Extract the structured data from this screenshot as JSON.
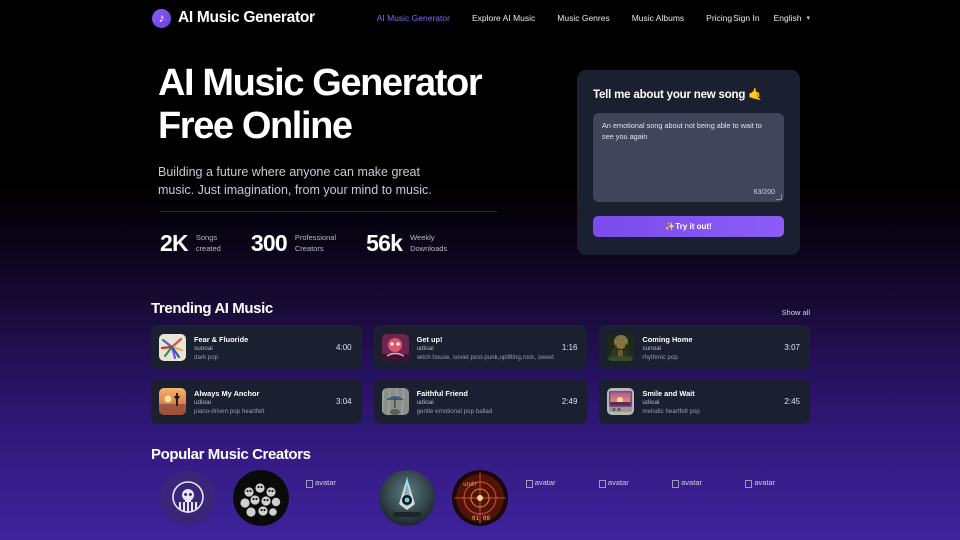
{
  "header": {
    "brand": "AI Music Generator",
    "logo_icon": "music-note-icon",
    "nav": [
      {
        "label": "AI Music Generator",
        "active": true
      },
      {
        "label": "Explore AI Music",
        "active": false
      },
      {
        "label": "Music Genres",
        "active": false
      },
      {
        "label": "Music Albums",
        "active": false
      },
      {
        "label": "Pricing",
        "active": false
      }
    ],
    "sign_in": "Sign In",
    "language": "English",
    "chevron_icon": "chevron-down-icon"
  },
  "hero": {
    "title_line1": "AI Music Generator",
    "title_line2": "Free Online",
    "subtitle": "Building a future where anyone can make great music. Just imagination, from your mind to music.",
    "stats": [
      {
        "number": "2K",
        "label_line1": "Songs",
        "label_line2": "created"
      },
      {
        "number": "300",
        "label_line1": "Professional",
        "label_line2": "Creators"
      },
      {
        "number": "56k",
        "label_line1": "Weekly",
        "label_line2": "Downloads"
      }
    ]
  },
  "prompt_card": {
    "title": "Tell me about your new song 🤙",
    "textarea_value": "An emotional song about not being able to wait to see you again",
    "textarea_placeholder": "Tell me about your new song",
    "counter": "63/200",
    "cta_label": "✨Try it out!",
    "accent_color": "#8b5cf6",
    "card_bg": "#1b2030"
  },
  "trending": {
    "title": "Trending AI Music",
    "show_all": "Show all",
    "tracks": [
      {
        "title": "Fear & Fluoride",
        "artist": "sunoai",
        "genre": "dark pop",
        "duration": "4:00"
      },
      {
        "title": "Get up!",
        "artist": "udioai",
        "genre": "witch house, soviet post-punk,uplifting,rock, sweet",
        "duration": "1:16"
      },
      {
        "title": "Coming Home",
        "artist": "sunoai",
        "genre": "rhythmic pop",
        "duration": "3:07"
      },
      {
        "title": "Always My Anchor",
        "artist": "udioai",
        "genre": "piano-driven pop heartfelt",
        "duration": "3:04"
      },
      {
        "title": "Faithful Friend",
        "artist": "udioai",
        "genre": "gentle emotional pop ballad",
        "duration": "2:49"
      },
      {
        "title": "Smile and Wait",
        "artist": "udioai",
        "genre": "melodic heartfelt pop",
        "duration": "2:45"
      }
    ]
  },
  "creators": {
    "title": "Popular Music Creators",
    "items": [
      {
        "alt": "avatar",
        "broken": false
      },
      {
        "alt": "avatar",
        "broken": false
      },
      {
        "alt": "avatar",
        "broken": true
      },
      {
        "alt": "avatar",
        "broken": false
      },
      {
        "alt": "avatar",
        "broken": false
      },
      {
        "alt": "avatar",
        "broken": true
      },
      {
        "alt": "avatar",
        "broken": true
      },
      {
        "alt": "avatar",
        "broken": true
      },
      {
        "alt": "avatar",
        "broken": true
      }
    ]
  }
}
